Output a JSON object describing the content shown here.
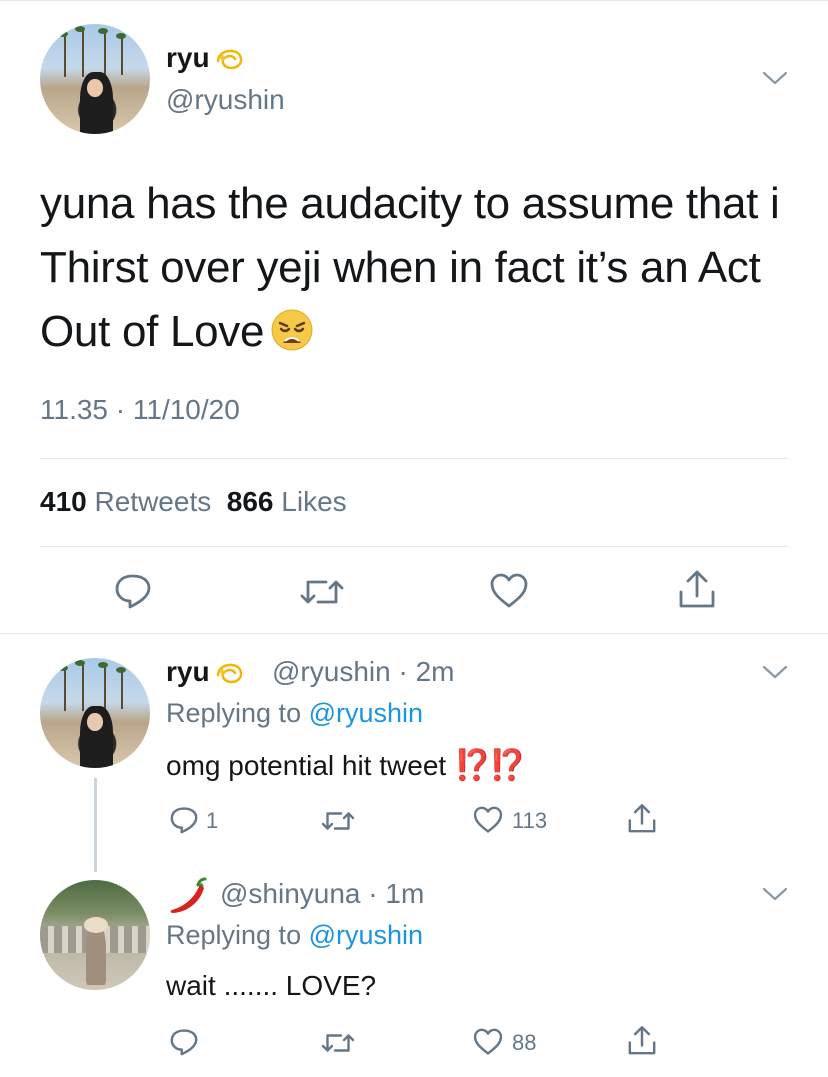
{
  "main_tweet": {
    "display_name": "ryu",
    "handle": "@ryushin",
    "text_lines": [
      "yuna has the audacity to assume that i",
      "Thirst over yeji when in fact it’s an Act",
      "Out of Love"
    ],
    "timestamp": "11.35 · 11/10/20",
    "retweets_count": "410",
    "retweets_label": "Retweets",
    "likes_count": "866",
    "likes_label": "Likes"
  },
  "replies": [
    {
      "display_name": "ryu",
      "handle_time": "@ryushin · 2m",
      "replying_prefix": "Replying to",
      "replying_to": "@ryushin",
      "text": "omg potential hit tweet",
      "emphasis": "⁉️⁉️",
      "reply_count": "1",
      "like_count": "113"
    },
    {
      "display_name": "",
      "handle_time": "@shinyuna · 1m",
      "replying_prefix": "Replying to",
      "replying_to": "@ryushin",
      "text": "wait ....... LOVE?",
      "like_count": "88"
    }
  ],
  "colors": {
    "text": "#14171a",
    "secondary": "#657786",
    "link": "#1b95e0",
    "divider": "#e1e8ed",
    "thread_line": "#ccd6dd"
  },
  "icons": [
    "sparkle-emoji-icon",
    "weary-face-emoji-icon",
    "chili-pepper-emoji-icon",
    "chevron-down-icon",
    "reply-icon",
    "retweet-icon",
    "like-icon",
    "share-icon"
  ]
}
